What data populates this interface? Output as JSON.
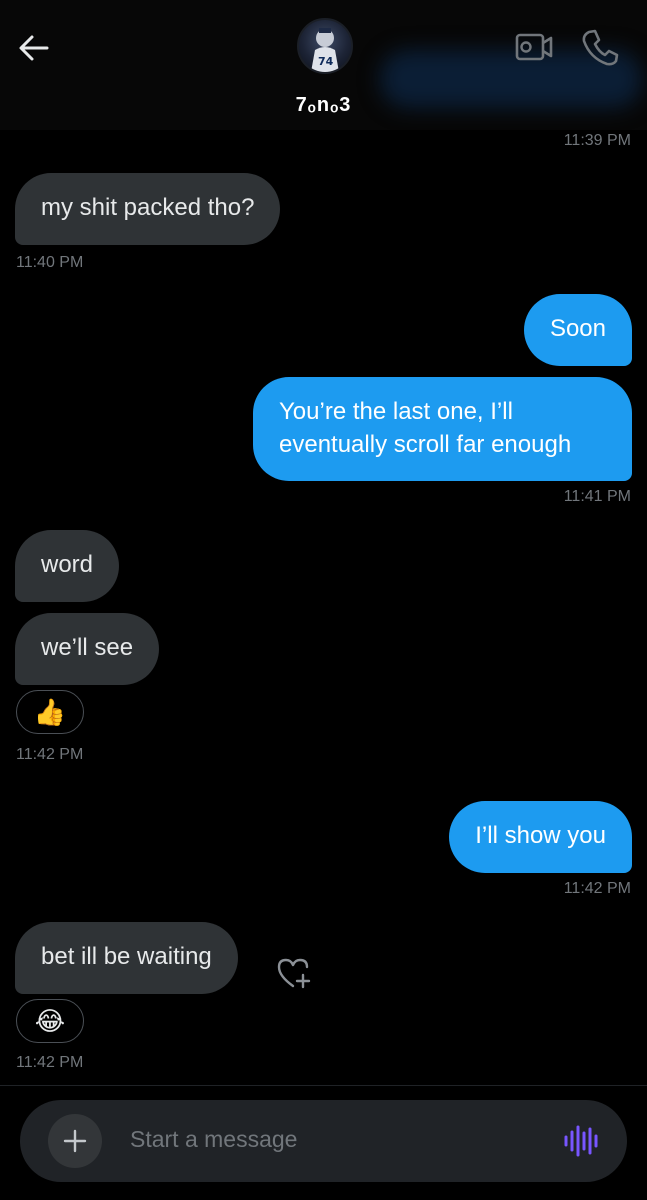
{
  "header": {
    "contact_name": "7ₒnₒ3",
    "avatar_text": "74"
  },
  "messages": [
    {
      "id": "ts-1139",
      "type": "timestamp",
      "text": "11:39 PM"
    },
    {
      "id": "m1",
      "direction": "received",
      "text": "my shit packed tho?"
    },
    {
      "id": "ts-1140",
      "type": "timestamp",
      "text": "11:40 PM"
    },
    {
      "id": "m2",
      "direction": "sent",
      "text": "Soon"
    },
    {
      "id": "m3",
      "direction": "sent",
      "text": "You’re the last one, I’ll eventually scroll far enough"
    },
    {
      "id": "ts-1141",
      "type": "timestamp",
      "text": "11:41 PM"
    },
    {
      "id": "m4",
      "direction": "received",
      "text": "word"
    },
    {
      "id": "m5",
      "direction": "received",
      "text": "we’ll see",
      "reaction": "👍"
    },
    {
      "id": "ts-1142a",
      "type": "timestamp",
      "text": "11:42 PM"
    },
    {
      "id": "m6",
      "direction": "sent",
      "text": "I’ll show you"
    },
    {
      "id": "ts-1142b",
      "type": "timestamp",
      "text": "11:42 PM"
    },
    {
      "id": "m7",
      "direction": "received",
      "text": "bet ill be waiting",
      "reaction": "😂"
    },
    {
      "id": "ts-1142c",
      "type": "timestamp",
      "text": "11:42 PM"
    }
  ],
  "composer": {
    "placeholder": "Start a message"
  },
  "icons": {
    "back": "arrow-left-icon",
    "video": "video-camera-icon",
    "call": "phone-icon",
    "add": "plus-icon",
    "voice": "voice-waveform-icon",
    "heart_add": "heart-plus-icon"
  },
  "colors": {
    "background": "#000000",
    "sent_bubble": "#1d9bf0",
    "received_bubble": "#2f3336",
    "timestamp": "#71767b",
    "voice_accent": "#7856ff"
  }
}
